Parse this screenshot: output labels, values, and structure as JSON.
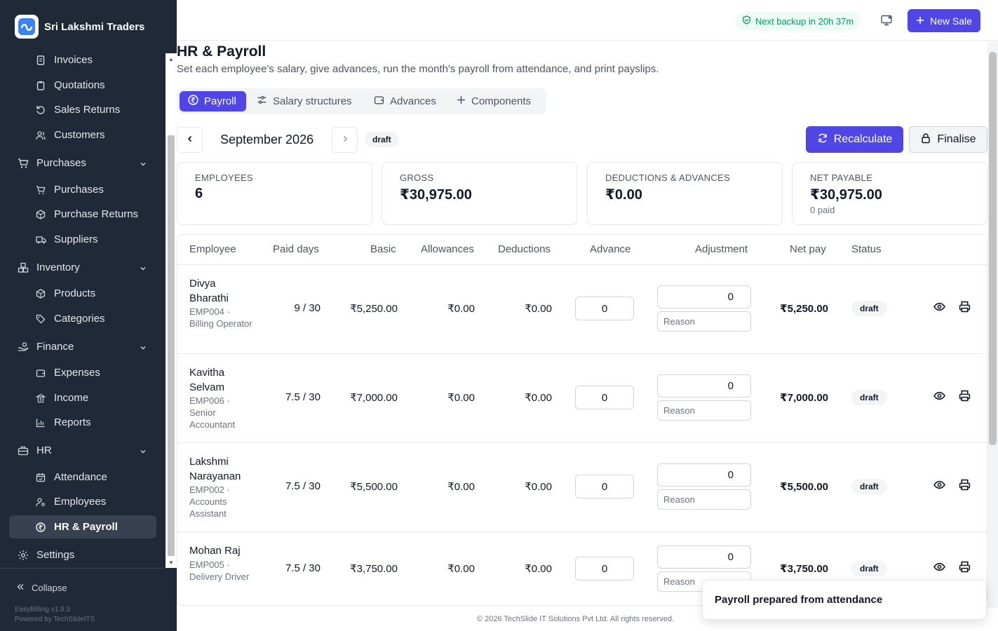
{
  "brand": {
    "name": "Sri Lakshmi Traders"
  },
  "nav": [
    {
      "label": "Invoices",
      "icon": "receipt-icon",
      "kind": "sub"
    },
    {
      "label": "Quotations",
      "icon": "clipboard-icon",
      "kind": "sub"
    },
    {
      "label": "Sales Returns",
      "icon": "rotate-ccw-icon",
      "kind": "sub"
    },
    {
      "label": "Customers",
      "icon": "users-icon",
      "kind": "sub"
    },
    {
      "label": "Purchases",
      "icon": "cart-icon",
      "kind": "group"
    },
    {
      "label": "Purchases",
      "icon": "cart-icon",
      "kind": "sub"
    },
    {
      "label": "Purchase Returns",
      "icon": "package-return-icon",
      "kind": "sub"
    },
    {
      "label": "Suppliers",
      "icon": "truck-icon",
      "kind": "sub"
    },
    {
      "label": "Inventory",
      "icon": "boxes-icon",
      "kind": "group"
    },
    {
      "label": "Products",
      "icon": "package-icon",
      "kind": "sub"
    },
    {
      "label": "Categories",
      "icon": "tags-icon",
      "kind": "sub"
    },
    {
      "label": "Finance",
      "icon": "hand-coins-icon",
      "kind": "group"
    },
    {
      "label": "Expenses",
      "icon": "wallet-icon",
      "kind": "sub"
    },
    {
      "label": "Income",
      "icon": "landmark-icon",
      "kind": "sub"
    },
    {
      "label": "Reports",
      "icon": "bar-chart-icon",
      "kind": "sub"
    },
    {
      "label": "HR",
      "icon": "briefcase-icon",
      "kind": "group"
    },
    {
      "label": "Attendance",
      "icon": "calendar-check-icon",
      "kind": "sub"
    },
    {
      "label": "Employees",
      "icon": "user-cog-icon",
      "kind": "sub"
    },
    {
      "label": "HR & Payroll",
      "icon": "rupee-circle-icon",
      "kind": "sub",
      "active": true
    },
    {
      "label": "Settings",
      "icon": "gear-icon",
      "kind": "group"
    }
  ],
  "sidebar_footer": {
    "collapse": "Collapse",
    "version": "EasyBilling v1.9.3",
    "powered": "Powered by TechSlideITS"
  },
  "topbar": {
    "backup": "Next backup in 20h 37m",
    "new_sale": "New Sale"
  },
  "page": {
    "title": "HR & Payroll",
    "subtitle": "Set each employee's salary, give advances, run the month's payroll from attendance, and print payslips."
  },
  "tabs": [
    {
      "label": "Payroll",
      "active": true
    },
    {
      "label": "Salary structures"
    },
    {
      "label": "Advances"
    },
    {
      "label": "Components"
    }
  ],
  "period": {
    "label": "September 2026",
    "status": "draft",
    "recalculate": "Recalculate",
    "finalise": "Finalise"
  },
  "stats": [
    {
      "label": "EMPLOYEES",
      "value": "6",
      "note": ""
    },
    {
      "label": "GROSS",
      "value": "₹30,975.00",
      "note": ""
    },
    {
      "label": "DEDUCTIONS & ADVANCES",
      "value": "₹0.00",
      "note": ""
    },
    {
      "label": "NET PAYABLE",
      "value": "₹30,975.00",
      "note": "0 paid"
    }
  ],
  "table": {
    "headers": {
      "employee": "Employee",
      "paid_days": "Paid days",
      "basic": "Basic",
      "allowances": "Allowances",
      "deductions": "Deductions",
      "advance": "Advance",
      "adjustment": "Adjustment",
      "net_pay": "Net pay",
      "status": "Status"
    },
    "rows": [
      {
        "name": "Divya Bharathi",
        "meta": "EMP004 · Billing Operator",
        "paid_days": "9 / 30",
        "basic": "₹5,250.00",
        "allowances": "₹0.00",
        "deductions": "₹0.00",
        "advance": "0",
        "adjustment": "0",
        "reason_placeholder": "Reason",
        "net_pay": "₹5,250.00",
        "status": "draft"
      },
      {
        "name": "Kavitha Selvam",
        "meta": "EMP006 · Senior Accountant",
        "paid_days": "7.5 / 30",
        "basic": "₹7,000.00",
        "allowances": "₹0.00",
        "deductions": "₹0.00",
        "advance": "0",
        "adjustment": "0",
        "reason_placeholder": "Reason",
        "net_pay": "₹7,000.00",
        "status": "draft"
      },
      {
        "name": "Lakshmi Narayanan",
        "meta": "EMP002 · Accounts Assistant",
        "paid_days": "7.5 / 30",
        "basic": "₹5,500.00",
        "allowances": "₹0.00",
        "deductions": "₹0.00",
        "advance": "0",
        "adjustment": "0",
        "reason_placeholder": "Reason",
        "net_pay": "₹5,500.00",
        "status": "draft"
      },
      {
        "name": "Mohan Raj",
        "meta": "EMP005 · Delivery Driver",
        "paid_days": "7.5 / 30",
        "basic": "₹3,750.00",
        "allowances": "₹0.00",
        "deductions": "₹0.00",
        "advance": "0",
        "adjustment": "0",
        "reason_placeholder": "Reason",
        "net_pay": "₹3,750.00",
        "status": "draft"
      }
    ]
  },
  "footer": {
    "copyright": "© 2026 TechSlide IT Solutions Pvt Ltd. All rights reserved."
  },
  "toast": {
    "message": "Payroll prepared from attendance"
  },
  "colors": {
    "primary": "#4f46e5",
    "sidebar": "#1f2937",
    "success": "#059669"
  }
}
